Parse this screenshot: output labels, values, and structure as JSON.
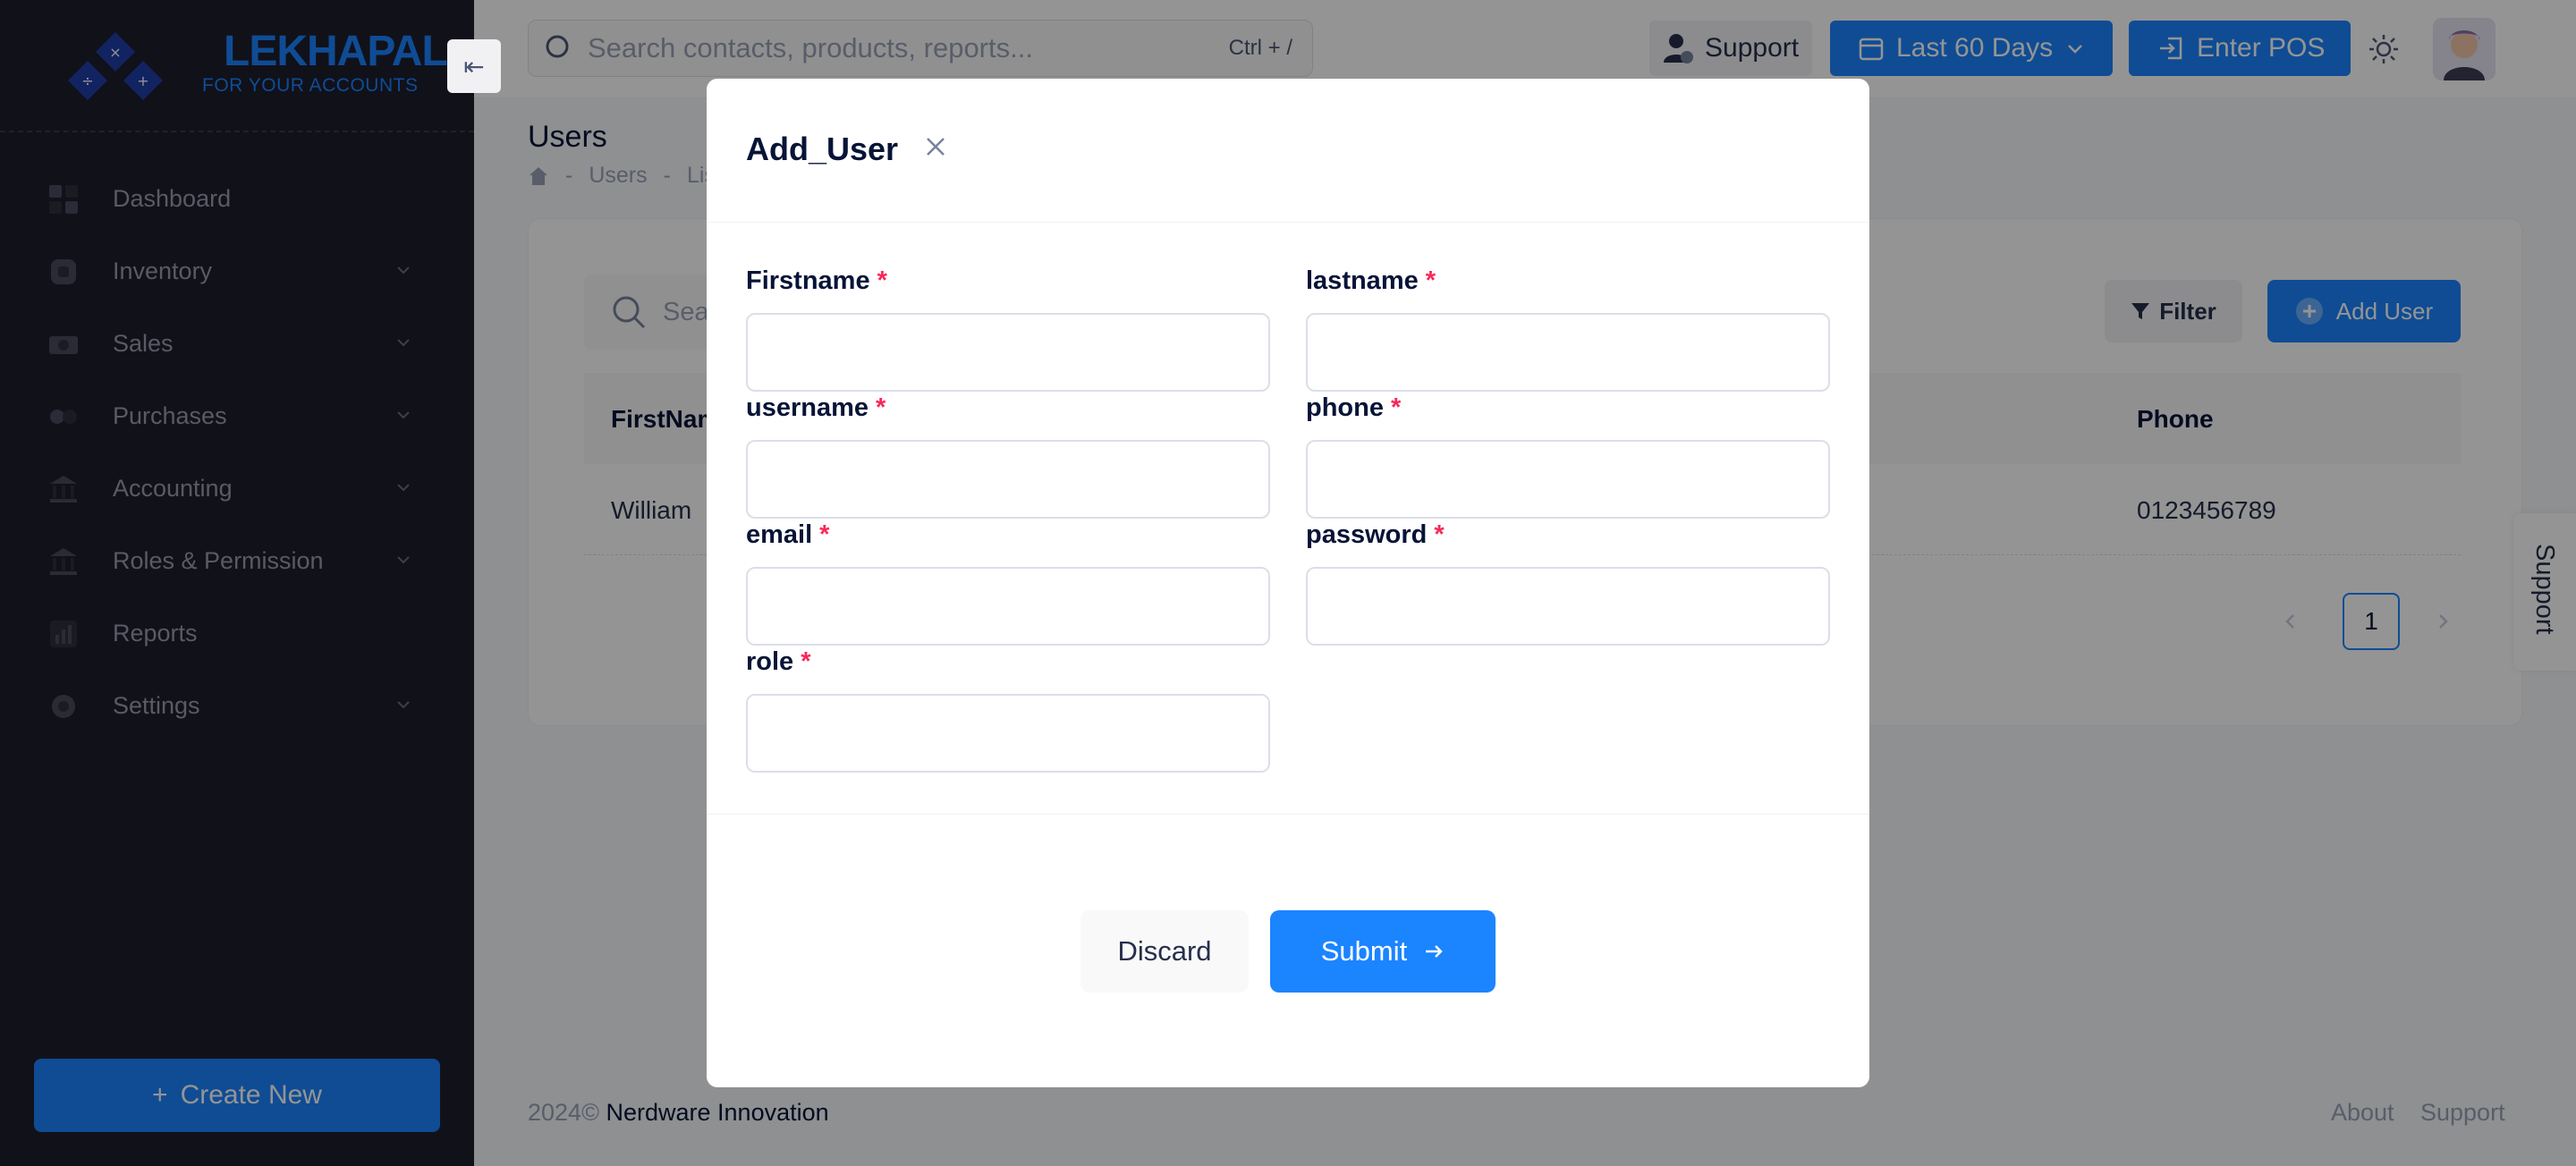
{
  "brand": {
    "name": "LEKHAPAL",
    "tagline": "FOR YOUR ACCOUNTS"
  },
  "sidebar": {
    "items": [
      {
        "label": "Dashboard",
        "icon": "dashboard-icon",
        "expandable": false
      },
      {
        "label": "Inventory",
        "icon": "inventory-icon",
        "expandable": true
      },
      {
        "label": "Sales",
        "icon": "sales-icon",
        "expandable": true
      },
      {
        "label": "Purchases",
        "icon": "purchases-icon",
        "expandable": true
      },
      {
        "label": "Accounting",
        "icon": "bank-icon",
        "expandable": true
      },
      {
        "label": "Roles & Permission",
        "icon": "bank-icon",
        "expandable": true
      },
      {
        "label": "Reports",
        "icon": "chart-icon",
        "expandable": false
      },
      {
        "label": "Settings",
        "icon": "gear-icon",
        "expandable": true
      }
    ],
    "create_new": "Create New"
  },
  "header": {
    "search_placeholder": "Search contacts, products, reports...",
    "search_shortcut": "Ctrl + /",
    "support": "Support",
    "date_range": "Last 60 Days",
    "enter_pos": "Enter POS"
  },
  "page": {
    "title": "Users",
    "breadcrumb": [
      "Users",
      "List"
    ]
  },
  "card": {
    "search_placeholder": "Search",
    "filter": "Filter",
    "add_user": "Add User",
    "columns": [
      "FirstName",
      "Phone"
    ],
    "rows": [
      {
        "firstname": "William",
        "phone": "0123456789"
      }
    ],
    "current_page": "1"
  },
  "footer": {
    "year": "2024©",
    "company": "Nerdware Innovation",
    "about": "About",
    "support": "Support"
  },
  "side_tab": {
    "support": "Support"
  },
  "modal": {
    "title": "Add_User",
    "fields": {
      "firstname": {
        "label": "Firstname",
        "value": ""
      },
      "lastname": {
        "label": "lastname",
        "value": ""
      },
      "username": {
        "label": "username",
        "value": ""
      },
      "phone": {
        "label": "phone",
        "value": ""
      },
      "email": {
        "label": "email",
        "value": ""
      },
      "password": {
        "label": "password",
        "value": ""
      },
      "role": {
        "label": "role",
        "value": ""
      }
    },
    "required_mark": "*",
    "discard": "Discard",
    "submit": "Submit"
  },
  "colors": {
    "primary": "#1b84ff",
    "sidebar_bg": "#1e1e2d",
    "required": "#f8285a"
  }
}
